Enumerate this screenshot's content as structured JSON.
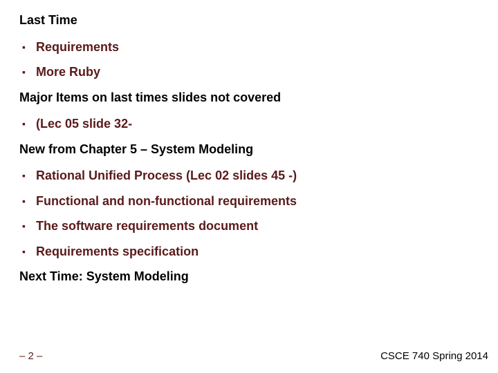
{
  "sections": [
    {
      "heading": "Last Time",
      "bullets": [
        "Requirements",
        "More Ruby"
      ]
    },
    {
      "heading": "Major Items on last times slides not covered",
      "bullets": [
        "(Lec 05 slide 32-"
      ]
    },
    {
      "heading": "New from Chapter 5 – System Modeling",
      "bullets": [
        "Rational Unified Process (Lec 02 slides 45 -)",
        "Functional and non-functional requirements",
        "The software requirements document",
        "Requirements specification"
      ]
    },
    {
      "heading": "Next Time: System Modeling",
      "bullets": []
    }
  ],
  "footer": {
    "page": "– 2 –",
    "course": "CSCE 740 Spring 2014"
  }
}
